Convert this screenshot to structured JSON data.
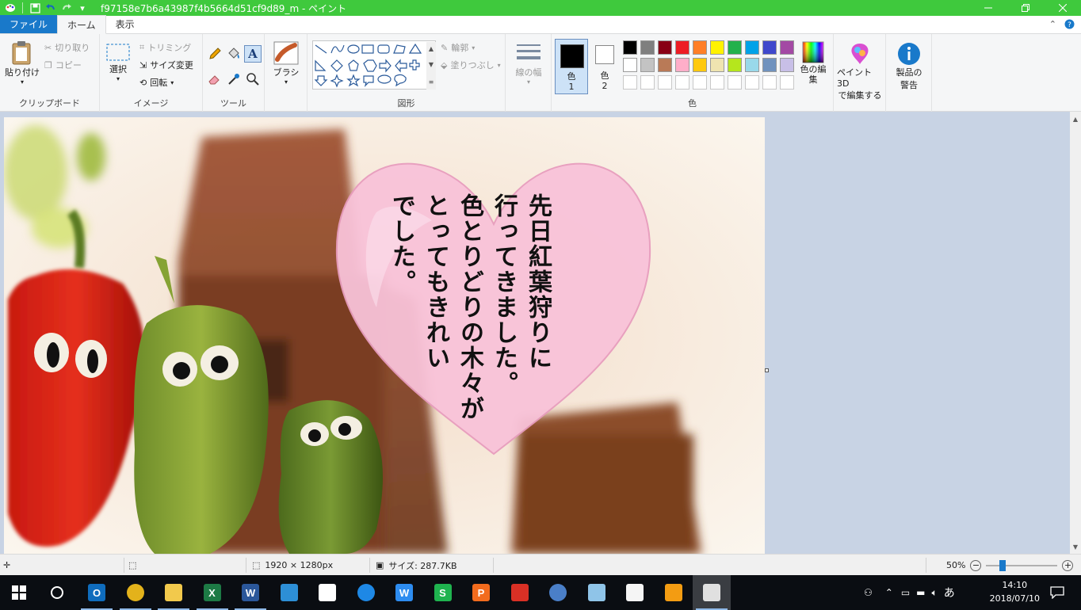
{
  "window": {
    "title": "f97158e7b6a43987f4b5664d51cf9d89_m - ペイント",
    "controls": [
      "minimize",
      "maximize",
      "close"
    ]
  },
  "quick_access": [
    "save-icon",
    "undo-icon",
    "redo-icon",
    "customize-icon"
  ],
  "tabs": [
    {
      "label": "ファイル",
      "active": false
    },
    {
      "label": "ホーム",
      "active": true
    },
    {
      "label": "表示",
      "active": false
    }
  ],
  "ribbon": {
    "clipboard": {
      "label": "クリップボード",
      "paste": "貼り付け",
      "cut": "切り取り",
      "copy": "コピー"
    },
    "image": {
      "label": "イメージ",
      "select": "選択",
      "crop": "トリミング",
      "resize": "サイズ変更",
      "rotate": "回転"
    },
    "tools": {
      "label": "ツール"
    },
    "brush": {
      "label": "ブラシ"
    },
    "shapes": {
      "label": "図形",
      "outline": "輪郭",
      "fill": "塗りつぶし"
    },
    "size": {
      "label": "線の幅"
    },
    "colors": {
      "label": "色",
      "color1": "色",
      "color1_num": "1",
      "color2": "色",
      "color2_num": "2",
      "color1_value": "#000000",
      "color2_value": "#ffffff",
      "edit_colors": "色の編集",
      "palette_row1": [
        "#000000",
        "#7f7f7f",
        "#880015",
        "#ed1c24",
        "#ff7f27",
        "#fff200",
        "#22b14c",
        "#00a2e8",
        "#3f48cc",
        "#a349a4"
      ],
      "palette_row2": [
        "#ffffff",
        "#c3c3c3",
        "#b97a57",
        "#ffaec9",
        "#ffc90e",
        "#efe4b0",
        "#b5e61d",
        "#99d9ea",
        "#7092be",
        "#c8bfe7"
      ]
    },
    "paint3d": {
      "label1": "ペイント 3D",
      "label2": "で編集する"
    },
    "product_alert": {
      "label1": "製品の",
      "label2": "警告"
    }
  },
  "canvas": {
    "heart_text": [
      "先日紅葉狩りに",
      "行ってきました。",
      "色とりどりの木々が",
      "とってもきれい",
      "でした。"
    ],
    "heart_color": "#f8c2d9"
  },
  "status": {
    "dimensions": "1920 × 1280px",
    "size": "サイズ: 287.7KB",
    "zoom": "50%"
  },
  "taskbar": {
    "apps": [
      "outlook-icon",
      "chrome-icon",
      "file-explorer-icon",
      "excel-icon",
      "word-icon",
      "contacts-icon",
      "mail-icon",
      "edge-icon",
      "wps-writer-icon",
      "wps-spreadsheet-icon",
      "wps-presentation-icon",
      "snipping-icon",
      "thunderbird-icon",
      "notepad-icon",
      "sticky-notes-icon",
      "media-player-icon",
      "paint-icon"
    ],
    "ime": "あ",
    "time": "14:10",
    "date": "2018/07/10"
  }
}
